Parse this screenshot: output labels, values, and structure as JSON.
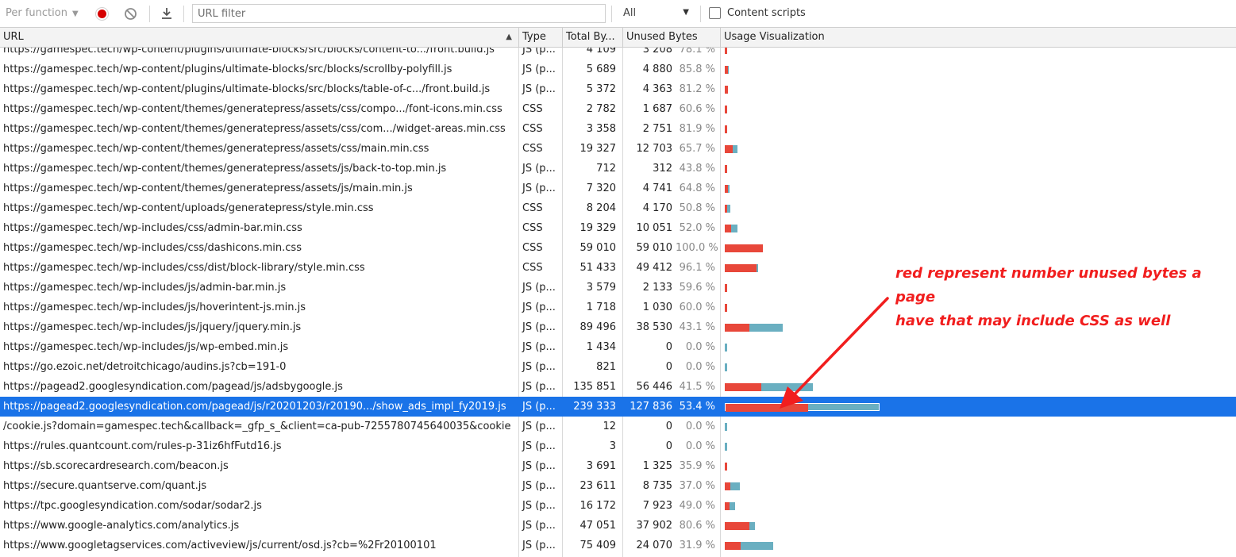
{
  "toolbar": {
    "per_function_label": "Per function",
    "url_filter_placeholder": "URL filter",
    "type_filter_value": "All",
    "content_scripts_label": "Content scripts",
    "content_scripts_checked": false
  },
  "columns": {
    "url": "URL",
    "type": "Type",
    "total": "Total By...",
    "unused": "Unused Bytes",
    "viz": "Usage Visualization"
  },
  "rows": [
    {
      "url": "https://gamespec.tech/wp-content/plugins/ultimate-blocks/src/blocks/content-to.../front.build.js",
      "type": "JS (p...",
      "total": "4 109",
      "unused": "3 208",
      "pct": "78.1 %",
      "total_bytes": 4109,
      "unused_bytes": 3208
    },
    {
      "url": "https://gamespec.tech/wp-content/plugins/ultimate-blocks/src/blocks/scrollby-polyfill.js",
      "type": "JS (p...",
      "total": "5 689",
      "unused": "4 880",
      "pct": "85.8 %",
      "total_bytes": 5689,
      "unused_bytes": 4880
    },
    {
      "url": "https://gamespec.tech/wp-content/plugins/ultimate-blocks/src/blocks/table-of-c.../front.build.js",
      "type": "JS (p...",
      "total": "5 372",
      "unused": "4 363",
      "pct": "81.2 %",
      "total_bytes": 5372,
      "unused_bytes": 4363
    },
    {
      "url": "https://gamespec.tech/wp-content/themes/generatepress/assets/css/compo.../font-icons.min.css",
      "type": "CSS",
      "total": "2 782",
      "unused": "1 687",
      "pct": "60.6 %",
      "total_bytes": 2782,
      "unused_bytes": 1687
    },
    {
      "url": "https://gamespec.tech/wp-content/themes/generatepress/assets/css/com.../widget-areas.min.css",
      "type": "CSS",
      "total": "3 358",
      "unused": "2 751",
      "pct": "81.9 %",
      "total_bytes": 3358,
      "unused_bytes": 2751
    },
    {
      "url": "https://gamespec.tech/wp-content/themes/generatepress/assets/css/main.min.css",
      "type": "CSS",
      "total": "19 327",
      "unused": "12 703",
      "pct": "65.7 %",
      "total_bytes": 19327,
      "unused_bytes": 12703
    },
    {
      "url": "https://gamespec.tech/wp-content/themes/generatepress/assets/js/back-to-top.min.js",
      "type": "JS (p...",
      "total": "712",
      "unused": "312",
      "pct": "43.8 %",
      "total_bytes": 712,
      "unused_bytes": 312
    },
    {
      "url": "https://gamespec.tech/wp-content/themes/generatepress/assets/js/main.min.js",
      "type": "JS (p...",
      "total": "7 320",
      "unused": "4 741",
      "pct": "64.8 %",
      "total_bytes": 7320,
      "unused_bytes": 4741
    },
    {
      "url": "https://gamespec.tech/wp-content/uploads/generatepress/style.min.css",
      "type": "CSS",
      "total": "8 204",
      "unused": "4 170",
      "pct": "50.8 %",
      "total_bytes": 8204,
      "unused_bytes": 4170
    },
    {
      "url": "https://gamespec.tech/wp-includes/css/admin-bar.min.css",
      "type": "CSS",
      "total": "19 329",
      "unused": "10 051",
      "pct": "52.0 %",
      "total_bytes": 19329,
      "unused_bytes": 10051
    },
    {
      "url": "https://gamespec.tech/wp-includes/css/dashicons.min.css",
      "type": "CSS",
      "total": "59 010",
      "unused": "59 010",
      "pct": "100.0 %",
      "total_bytes": 59010,
      "unused_bytes": 59010
    },
    {
      "url": "https://gamespec.tech/wp-includes/css/dist/block-library/style.min.css",
      "type": "CSS",
      "total": "51 433",
      "unused": "49 412",
      "pct": "96.1 %",
      "total_bytes": 51433,
      "unused_bytes": 49412
    },
    {
      "url": "https://gamespec.tech/wp-includes/js/admin-bar.min.js",
      "type": "JS (p...",
      "total": "3 579",
      "unused": "2 133",
      "pct": "59.6 %",
      "total_bytes": 3579,
      "unused_bytes": 2133
    },
    {
      "url": "https://gamespec.tech/wp-includes/js/hoverintent-js.min.js",
      "type": "JS (p...",
      "total": "1 718",
      "unused": "1 030",
      "pct": "60.0 %",
      "total_bytes": 1718,
      "unused_bytes": 1030
    },
    {
      "url": "https://gamespec.tech/wp-includes/js/jquery/jquery.min.js",
      "type": "JS (p...",
      "total": "89 496",
      "unused": "38 530",
      "pct": "43.1 %",
      "total_bytes": 89496,
      "unused_bytes": 38530
    },
    {
      "url": "https://gamespec.tech/wp-includes/js/wp-embed.min.js",
      "type": "JS (p...",
      "total": "1 434",
      "unused": "0",
      "pct": "0.0 %",
      "total_bytes": 1434,
      "unused_bytes": 0
    },
    {
      "url": "https://go.ezoic.net/detroitchicago/audins.js?cb=191-0",
      "type": "JS (p...",
      "total": "821",
      "unused": "0",
      "pct": "0.0 %",
      "total_bytes": 821,
      "unused_bytes": 0
    },
    {
      "url": "https://pagead2.googlesyndication.com/pagead/js/adsbygoogle.js",
      "type": "JS (p...",
      "total": "135 851",
      "unused": "56 446",
      "pct": "41.5 %",
      "total_bytes": 135851,
      "unused_bytes": 56446
    },
    {
      "url": "https://pagead2.googlesyndication.com/pagead/js/r20201203/r20190.../show_ads_impl_fy2019.js",
      "type": "JS (p...",
      "total": "239 333",
      "unused": "127 836",
      "pct": "53.4 %",
      "total_bytes": 239333,
      "unused_bytes": 127836,
      "selected": true
    },
    {
      "url": "/cookie.js?domain=gamespec.tech&callback=_gfp_s_&client=ca-pub-7255780745640035&cookie",
      "type": "JS (p...",
      "total": "12",
      "unused": "0",
      "pct": "0.0 %",
      "total_bytes": 12,
      "unused_bytes": 0
    },
    {
      "url": "https://rules.quantcount.com/rules-p-31iz6hfFutd16.js",
      "type": "JS (p...",
      "total": "3",
      "unused": "0",
      "pct": "0.0 %",
      "total_bytes": 3,
      "unused_bytes": 0
    },
    {
      "url": "https://sb.scorecardresearch.com/beacon.js",
      "type": "JS (p...",
      "total": "3 691",
      "unused": "1 325",
      "pct": "35.9 %",
      "total_bytes": 3691,
      "unused_bytes": 1325
    },
    {
      "url": "https://secure.quantserve.com/quant.js",
      "type": "JS (p...",
      "total": "23 611",
      "unused": "8 735",
      "pct": "37.0 %",
      "total_bytes": 23611,
      "unused_bytes": 8735
    },
    {
      "url": "https://tpc.googlesyndication.com/sodar/sodar2.js",
      "type": "JS (p...",
      "total": "16 172",
      "unused": "7 923",
      "pct": "49.0 %",
      "total_bytes": 16172,
      "unused_bytes": 7923
    },
    {
      "url": "https://www.google-analytics.com/analytics.js",
      "type": "JS (p...",
      "total": "47 051",
      "unused": "37 902",
      "pct": "80.6 %",
      "total_bytes": 47051,
      "unused_bytes": 37902
    },
    {
      "url": "https://www.googletagservices.com/activeview/js/current/osd.js?cb=%2Fr20100101",
      "type": "JS (p...",
      "total": "75 409",
      "unused": "24 070",
      "pct": "31.9 %",
      "total_bytes": 75409,
      "unused_bytes": 24070
    }
  ],
  "annotation": {
    "line1": "red represent number unused bytes a page",
    "line2": "have that may include CSS as well"
  },
  "colors": {
    "unused": "#e8473a",
    "used": "#6aafc1",
    "selection": "#1a73e8",
    "annotation": "#f11e1e"
  }
}
